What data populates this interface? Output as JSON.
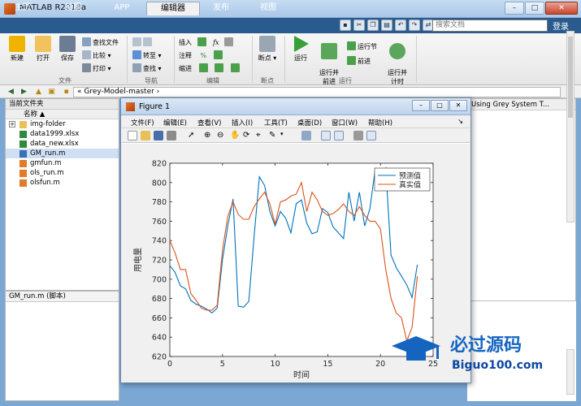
{
  "window": {
    "title": "MATLAB R2018a",
    "buttons": [
      "–",
      "□",
      "✕"
    ]
  },
  "tabs": [
    {
      "label": "主页",
      "active": false
    },
    {
      "label": "绘图",
      "active": false
    },
    {
      "label": "APP",
      "active": false
    },
    {
      "label": "编辑器",
      "active": true
    },
    {
      "label": "发布",
      "active": false
    },
    {
      "label": "视图",
      "active": false
    }
  ],
  "search": {
    "placeholder": "搜索文档"
  },
  "login_label": "登录",
  "ribbon": {
    "file_group": {
      "label": "文件",
      "new": "新建",
      "open": "打开",
      "save": "保存",
      "find_files": "查找文件",
      "compare": "比较",
      "print": "打印"
    },
    "nav_group": {
      "label": "导航",
      "goto": "转至",
      "find": "查找"
    },
    "edit_group": {
      "label": "编辑",
      "insert": "插入",
      "comment": "注释",
      "indent": "缩进"
    },
    "breakpoint_group": {
      "label": "断点",
      "breakpoints": "断点"
    },
    "run_group": {
      "label": "运行",
      "run": "运行",
      "run_advance": "运行并\n前进",
      "run_section": "运行节",
      "advance": "前进",
      "run_time": "运行并\n计时"
    }
  },
  "address": {
    "path": "« Grey-Model-master ›"
  },
  "current_folder": {
    "title": "当前文件夹",
    "column_header": "名称 ▲",
    "files": [
      {
        "name": "img-folder",
        "type": "folder",
        "selected": false
      },
      {
        "name": "data1999.xlsx",
        "type": "xlsx",
        "selected": false
      },
      {
        "name": "data_new.xlsx",
        "type": "xlsx",
        "selected": false
      },
      {
        "name": "GM_run.m",
        "type": "m",
        "selected": true
      },
      {
        "name": "gmfun.m",
        "type": "m",
        "selected": false
      },
      {
        "name": "ols_run.m",
        "type": "m",
        "selected": false
      },
      {
        "name": "olsfun.m",
        "type": "m",
        "selected": false
      }
    ]
  },
  "details": {
    "title": "GM_run.m  (脚本)"
  },
  "editor_tab": {
    "title": "Using Grey System T..."
  },
  "figure": {
    "title": "Figure 1",
    "menus": [
      "文件(F)",
      "编辑(E)",
      "查看(V)",
      "插入(I)",
      "工具(T)",
      "桌面(D)",
      "窗口(W)",
      "帮助(H)"
    ]
  },
  "chart_data": {
    "type": "line",
    "title": "",
    "xlabel": "时间",
    "ylabel": "用电量",
    "xlim": [
      0,
      25
    ],
    "ylim": [
      620,
      820
    ],
    "xticks": [
      0,
      5,
      10,
      15,
      20,
      25
    ],
    "yticks": [
      620,
      640,
      660,
      680,
      700,
      720,
      740,
      760,
      780,
      800,
      820
    ],
    "legend_position": "top-right",
    "series": [
      {
        "name": "预测值",
        "color": "#0072bd",
        "x": [
          0,
          0.5,
          1,
          1.5,
          2,
          2.5,
          3,
          3.5,
          4,
          4.5,
          5,
          5.5,
          6,
          6.5,
          7,
          7.5,
          8,
          8.5,
          9,
          9.5,
          10,
          10.5,
          11,
          11.5,
          12,
          12.5,
          13,
          13.5,
          14,
          14.5,
          15,
          15.5,
          16,
          16.5,
          17,
          17.5,
          18,
          18.5,
          19,
          19.5,
          20,
          20.5,
          21,
          21.5,
          22,
          22.5,
          23,
          23.5
        ],
        "values": [
          714,
          707,
          693,
          690,
          678,
          674,
          672,
          669,
          665,
          670,
          720,
          755,
          783,
          672,
          671,
          677,
          744,
          806,
          797,
          770,
          755,
          770,
          763,
          748,
          778,
          782,
          758,
          747,
          749,
          773,
          769,
          754,
          748,
          742,
          790,
          760,
          790,
          755,
          773,
          813,
          807,
          815,
          725,
          712,
          703,
          694,
          681,
          715
        ]
      },
      {
        "name": "真实值",
        "color": "#d95319",
        "x": [
          0,
          0.5,
          1,
          1.5,
          2,
          2.5,
          3,
          3.5,
          4,
          4.5,
          5,
          5.5,
          6,
          6.5,
          7,
          7.5,
          8,
          8.5,
          9,
          9.5,
          10,
          10.5,
          11,
          11.5,
          12,
          12.5,
          13,
          13.5,
          14,
          14.5,
          15,
          15.5,
          16,
          16.5,
          17,
          17.5,
          18,
          18.5,
          19,
          19.5,
          20,
          20.5,
          21,
          21.5,
          22,
          22.5,
          23,
          23.5
        ],
        "values": [
          740,
          727,
          710,
          710,
          685,
          678,
          670,
          668,
          668,
          673,
          730,
          765,
          780,
          767,
          762,
          762,
          775,
          783,
          790,
          778,
          757,
          780,
          782,
          786,
          788,
          800,
          770,
          790,
          782,
          770,
          766,
          768,
          772,
          778,
          770,
          766,
          775,
          766,
          760,
          760,
          752,
          710,
          680,
          665,
          660,
          636,
          650,
          703
        ]
      }
    ]
  }
}
